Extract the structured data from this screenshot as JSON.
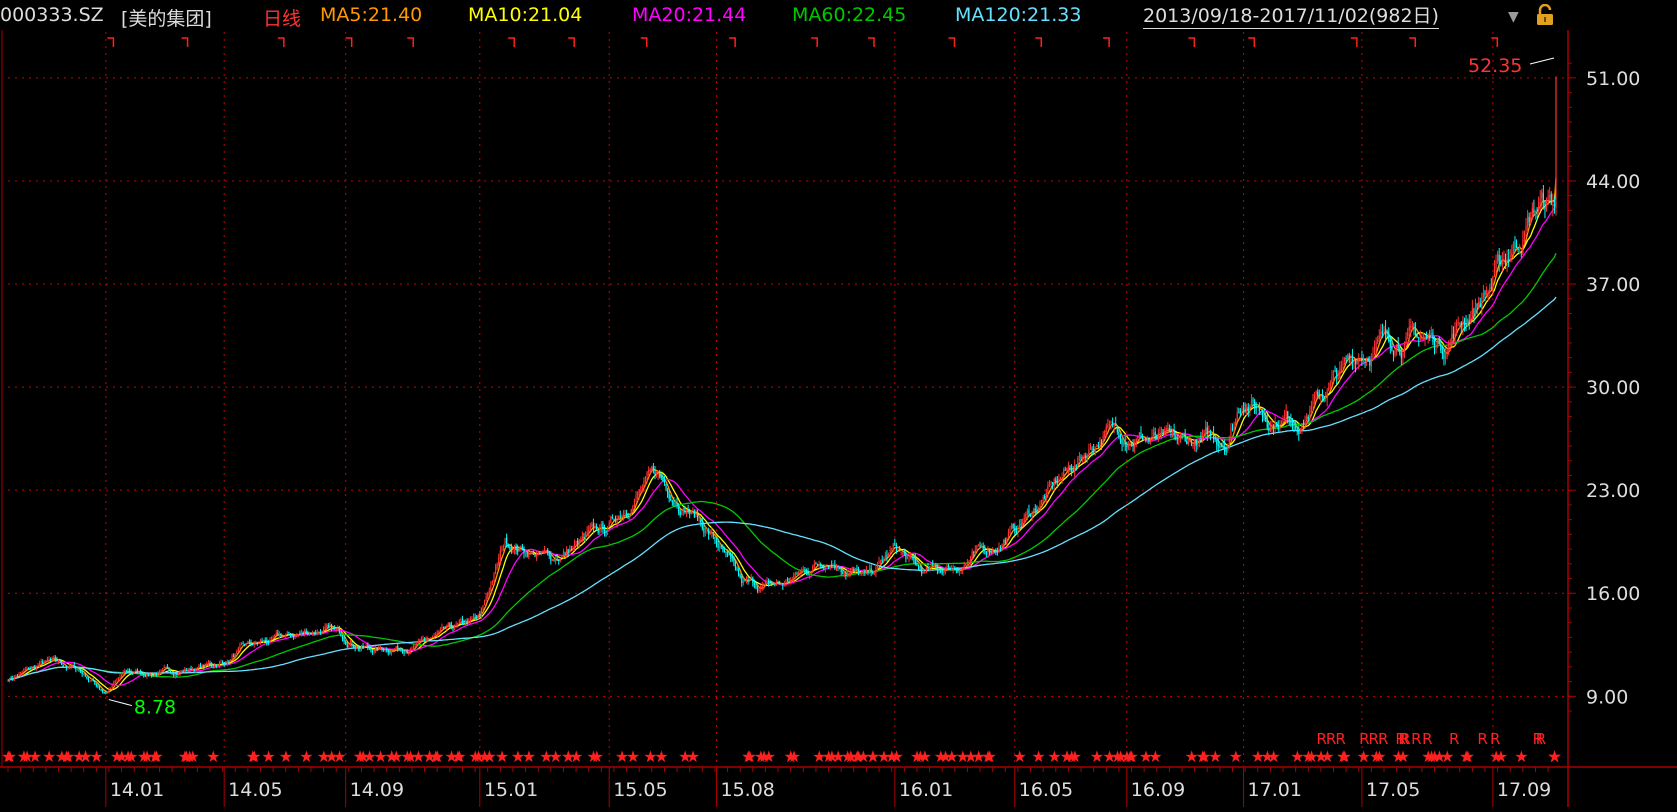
{
  "header": {
    "code": "000333.SZ",
    "name": "[美的集团]",
    "period": "日线",
    "ma5": "MA5:21.40",
    "ma10": "MA10:21.04",
    "ma20": "MA20:21.44",
    "ma60": "MA60:22.45",
    "ma120": "MA120:21.33",
    "range": "2013/09/18-2017/11/02(982日)"
  },
  "colors": {
    "up": "#ff3333",
    "down": "#00ffff",
    "ma5": "#ff9900",
    "ma10": "#ffff00",
    "ma20": "#ff00ff",
    "ma60": "#00c800",
    "ma120": "#66e0ff",
    "grid": "#cc0000",
    "axis_text": "#dddddd"
  },
  "icons": [
    "dropdown-arrow-icon",
    "lock-icon"
  ],
  "chart_data": {
    "type": "candlestick",
    "x_ticks": [
      "14.01",
      "14.05",
      "14.09",
      "15.01",
      "15.05",
      "15.08",
      "16.01",
      "16.05",
      "16.09",
      "17.01",
      "17.05",
      "17.09"
    ],
    "x_tick_index": [
      62,
      137,
      214,
      299,
      381,
      449,
      562,
      638,
      709,
      783,
      858,
      941
    ],
    "x_total": 982,
    "y_ticks": [
      "51.00",
      "44.00",
      "37.00",
      "30.00",
      "23.00",
      "16.00",
      "9.00"
    ],
    "y_tick_values": [
      51,
      44,
      37,
      30,
      23,
      16,
      9
    ],
    "ylim": [
      4.2,
      52.35
    ],
    "high_label": "52.35",
    "low_label": "8.78",
    "anchors": [
      [
        0,
        10.2
      ],
      [
        25,
        11.3
      ],
      [
        45,
        10.8
      ],
      [
        62,
        9.3
      ],
      [
        75,
        10.6
      ],
      [
        100,
        10.6
      ],
      [
        137,
        11.3
      ],
      [
        150,
        12.3
      ],
      [
        200,
        13.6
      ],
      [
        230,
        12.2
      ],
      [
        260,
        12.5
      ],
      [
        299,
        14.2
      ],
      [
        315,
        19.5
      ],
      [
        345,
        18.3
      ],
      [
        381,
        20.5
      ],
      [
        395,
        22.5
      ],
      [
        410,
        24.0
      ],
      [
        432,
        21.8
      ],
      [
        449,
        19.5
      ],
      [
        465,
        16.4
      ],
      [
        490,
        16.5
      ],
      [
        520,
        18.5
      ],
      [
        545,
        17.0
      ],
      [
        562,
        19.0
      ],
      [
        580,
        17.3
      ],
      [
        600,
        17.8
      ],
      [
        625,
        19.2
      ],
      [
        638,
        20.3
      ],
      [
        665,
        23.5
      ],
      [
        695,
        27.0
      ],
      [
        709,
        27.0
      ],
      [
        740,
        26.0
      ],
      [
        772,
        26.5
      ],
      [
        783,
        29.5
      ],
      [
        800,
        28.0
      ],
      [
        820,
        28.0
      ],
      [
        858,
        32.5
      ],
      [
        880,
        33.5
      ],
      [
        910,
        33.0
      ],
      [
        940,
        37.0
      ],
      [
        970,
        42.5
      ],
      [
        1000,
        42.0
      ],
      [
        1020,
        40.5
      ],
      [
        1050,
        41.0
      ],
      [
        1060,
        43.0
      ],
      [
        1075,
        48.0
      ],
      [
        1090,
        51.0
      ]
    ],
    "signals_top_count": 19,
    "signals_bottom": [
      "★",
      "R"
    ],
    "ma_series": [
      "MA5",
      "MA10",
      "MA20",
      "MA60",
      "MA120"
    ]
  }
}
